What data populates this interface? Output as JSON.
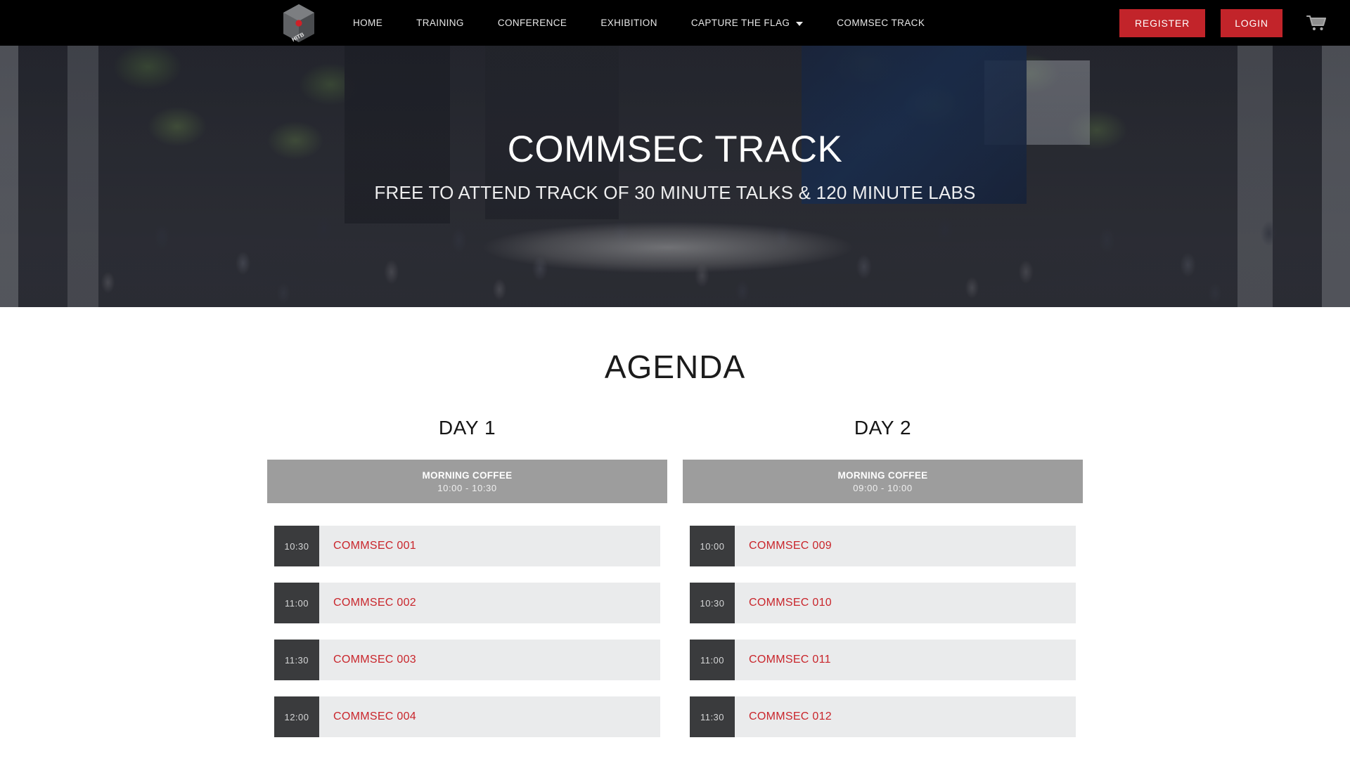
{
  "nav": {
    "logo_name": "hitb-logo",
    "links": [
      {
        "label": "HOME",
        "has_dropdown": false
      },
      {
        "label": "TRAINING",
        "has_dropdown": false
      },
      {
        "label": "CONFERENCE",
        "has_dropdown": false
      },
      {
        "label": "EXHIBITION",
        "has_dropdown": false
      },
      {
        "label": "CAPTURE THE FLAG",
        "has_dropdown": true
      },
      {
        "label": "COMMSEC TRACK",
        "has_dropdown": false
      }
    ],
    "register_label": "REGISTER",
    "login_label": "LOGIN",
    "cart_icon": "shopping-cart-icon",
    "colors": {
      "bar_background": "#000000",
      "button_red": "#c2242a",
      "link_text": "#e8e8e8"
    }
  },
  "hero": {
    "title": "COMMSEC TRACK",
    "subtitle": "FREE TO ATTEND TRACK OF 30 MINUTE TALKS & 120 MINUTE LABS"
  },
  "agenda": {
    "title": "AGENDA",
    "accent_color": "#c9252b",
    "break_block_color": "#9d9d9d",
    "time_block_color": "#3a3b3d",
    "session_body_color": "#eaebec",
    "days": [
      {
        "heading": "DAY 1",
        "break": {
          "title": "MORNING COFFEE",
          "time": "10:00 - 10:30"
        },
        "sessions": [
          {
            "time": "10:30",
            "title": "COMMSEC 001"
          },
          {
            "time": "11:00",
            "title": "COMMSEC 002"
          },
          {
            "time": "11:30",
            "title": "COMMSEC 003"
          },
          {
            "time": "12:00",
            "title": "COMMSEC 004"
          }
        ]
      },
      {
        "heading": "DAY 2",
        "break": {
          "title": "MORNING COFFEE",
          "time": "09:00 - 10:00"
        },
        "sessions": [
          {
            "time": "10:00",
            "title": "COMMSEC 009"
          },
          {
            "time": "10:30",
            "title": "COMMSEC 010"
          },
          {
            "time": "11:00",
            "title": "COMMSEC 011"
          },
          {
            "time": "11:30",
            "title": "COMMSEC 012"
          }
        ]
      }
    ]
  }
}
